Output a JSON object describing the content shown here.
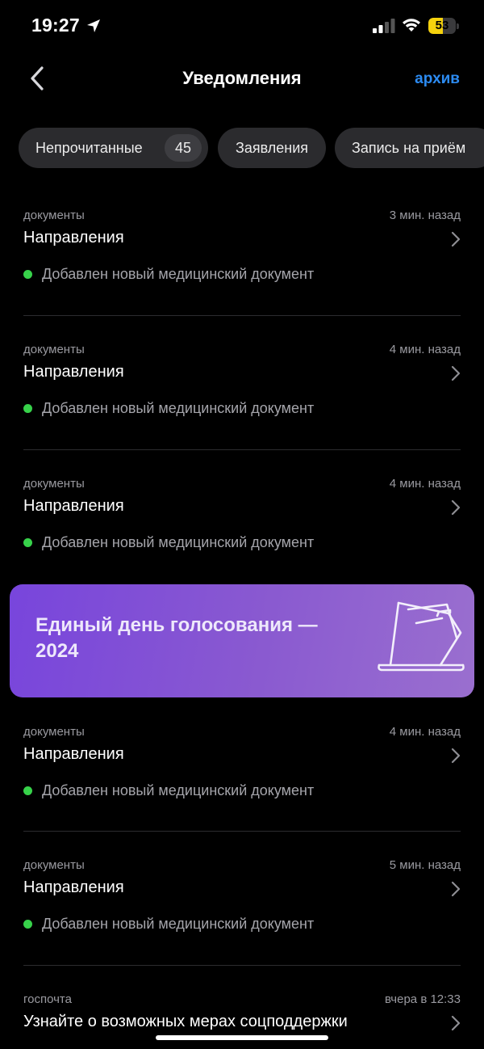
{
  "status_bar": {
    "time": "19:27",
    "battery": "53",
    "battery_level": 0.53
  },
  "nav": {
    "title": "Уведомления",
    "archive_label": "архив"
  },
  "filters": [
    {
      "label": "Непрочитанные",
      "count": "45"
    },
    {
      "label": "Заявления"
    },
    {
      "label": "Запись на приём"
    }
  ],
  "notifications": [
    {
      "category": "документы",
      "time": "3 мин. назад",
      "title": "Направления",
      "description": "Добавлен новый медицинский документ"
    },
    {
      "category": "документы",
      "time": "4 мин. назад",
      "title": "Направления",
      "description": "Добавлен новый медицинский документ"
    },
    {
      "category": "документы",
      "time": "4 мин. назад",
      "title": "Направления",
      "description": "Добавлен новый медицинский документ"
    },
    {
      "category": "документы",
      "time": "4 мин. назад",
      "title": "Направления",
      "description": "Добавлен новый медицинский документ"
    },
    {
      "category": "документы",
      "time": "5 мин. назад",
      "title": "Направления",
      "description": "Добавлен новый медицинский документ"
    },
    {
      "category": "госпочта",
      "time": "вчера в 12:33",
      "title": "Узнайте о возможных мерах соцподдержки"
    }
  ],
  "banner": {
    "title": "Единый день голосования — 2024",
    "icon": "ballot-box-icon"
  },
  "colors": {
    "accent": "#2c8bf2",
    "unread_dot": "#37d24a",
    "banner_start": "#7845dc",
    "banner_end": "#9a6fcf",
    "battery": "#f5d20d"
  }
}
